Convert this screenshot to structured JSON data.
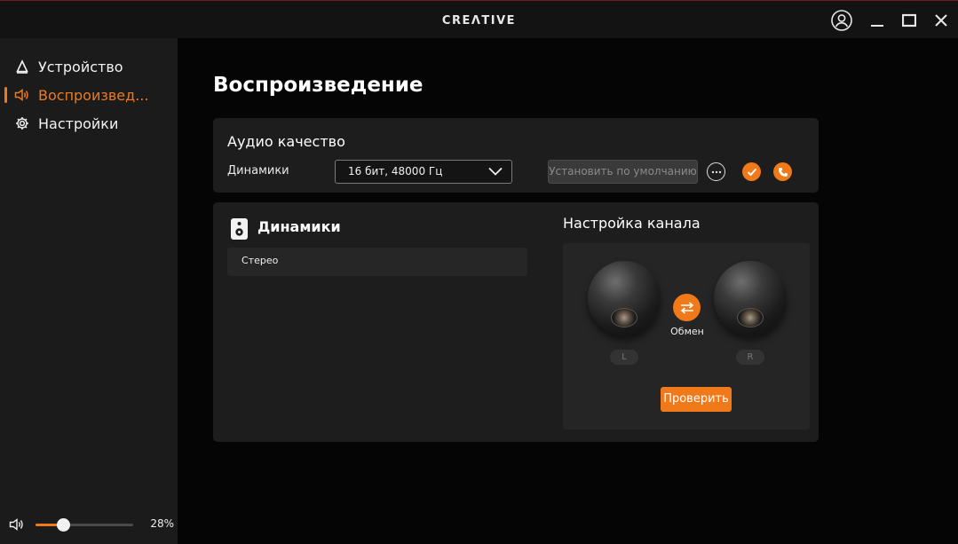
{
  "app": {
    "logo": "CREΛTIVE"
  },
  "sidebar": {
    "items": [
      {
        "label": "Устройство",
        "icon": "device-icon"
      },
      {
        "label": "Воспроизвед...",
        "icon": "speaker-icon"
      },
      {
        "label": "Настройки",
        "icon": "gear-icon"
      }
    ],
    "volume": {
      "value": 28,
      "label": "28%"
    }
  },
  "main": {
    "title": "Воспроизведение",
    "audio_quality": {
      "heading": "Аудио качество",
      "device_label": "Динамики",
      "format_value": "16 бит, 48000 Гц",
      "default_button": "Установить по умолчанию"
    },
    "speakers": {
      "heading": "Динамики",
      "mode": "Стерео"
    },
    "channel": {
      "heading": "Настройка канала",
      "swap_label": "Обмен",
      "left": "L",
      "right": "R",
      "test_button": "Проверить"
    }
  },
  "colors": {
    "accent": "#f07a1a",
    "panel": "#1d1d1d",
    "sidebar": "#1b1b1b"
  }
}
